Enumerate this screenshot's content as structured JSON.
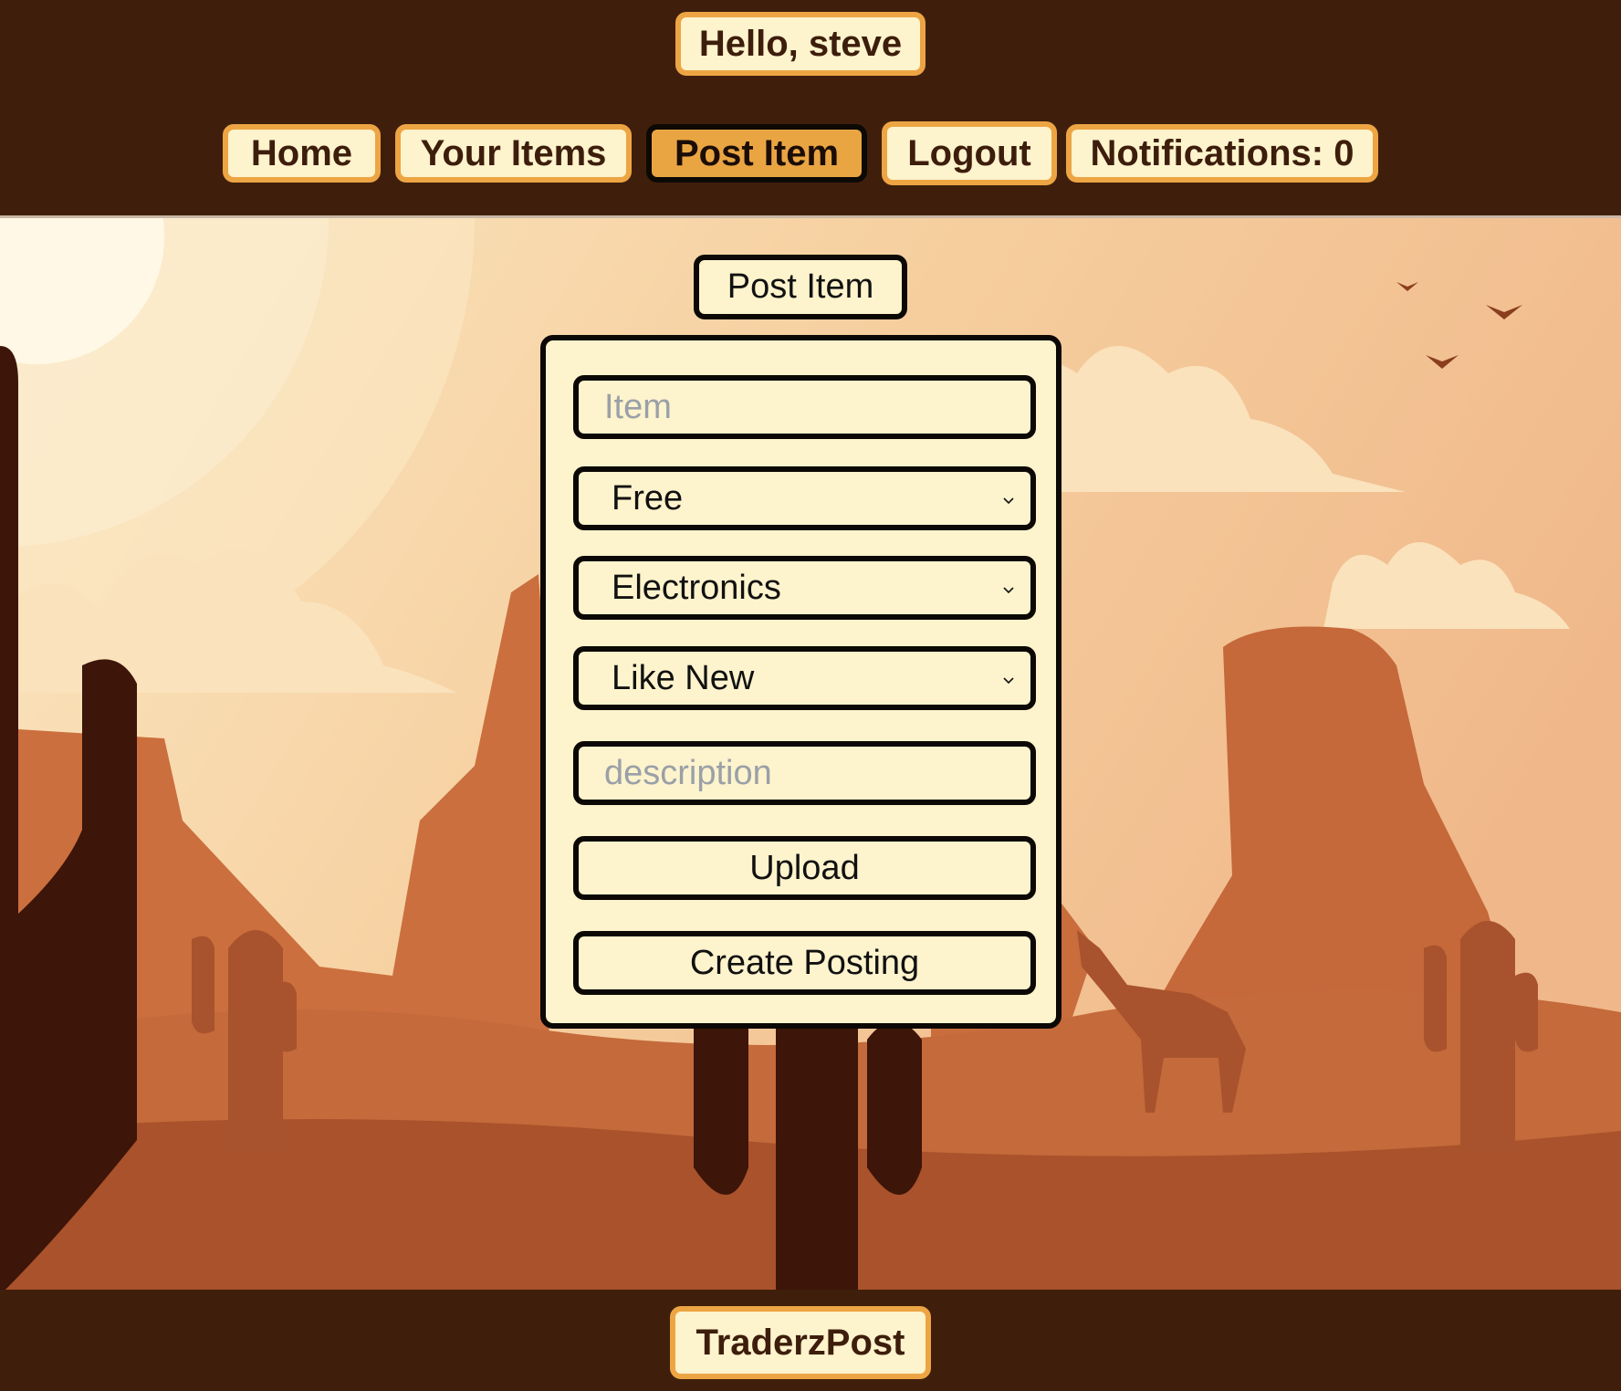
{
  "header": {
    "greeting": "Hello, steve",
    "nav": [
      {
        "label": "Home"
      },
      {
        "label": "Your Items"
      },
      {
        "label": "Post Item"
      },
      {
        "label": "Logout"
      },
      {
        "label": "Notifications: 0"
      }
    ]
  },
  "form": {
    "title": "Post Item",
    "item_placeholder": "Item",
    "price_selected": "Free",
    "category_selected": "Electronics",
    "condition_selected": "Like New",
    "description_placeholder": "description",
    "upload_label": "Upload",
    "submit_label": "Create Posting"
  },
  "footer": {
    "brand": "TraderzPost"
  },
  "icons": {
    "dropdown": "chevron-down-icon"
  },
  "colors": {
    "dark_brown": "#3f1f0c",
    "cream": "#fdf3cc",
    "accent_orange": "#eda544"
  }
}
